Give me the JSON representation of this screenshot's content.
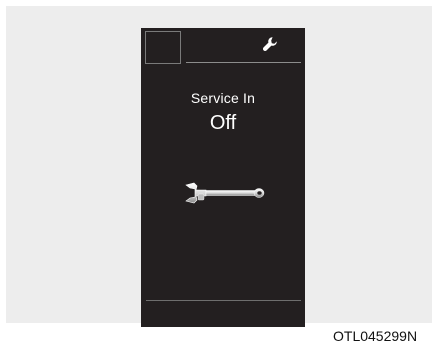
{
  "display": {
    "title": "Service In",
    "value": "Off",
    "header_icon": "wrench-icon",
    "center_icon": "adjustable-wrench-icon"
  },
  "caption": "OTL045299N",
  "colors": {
    "screen_background": "#231f20",
    "page_background": "#ededed",
    "text": "#ffffff"
  }
}
